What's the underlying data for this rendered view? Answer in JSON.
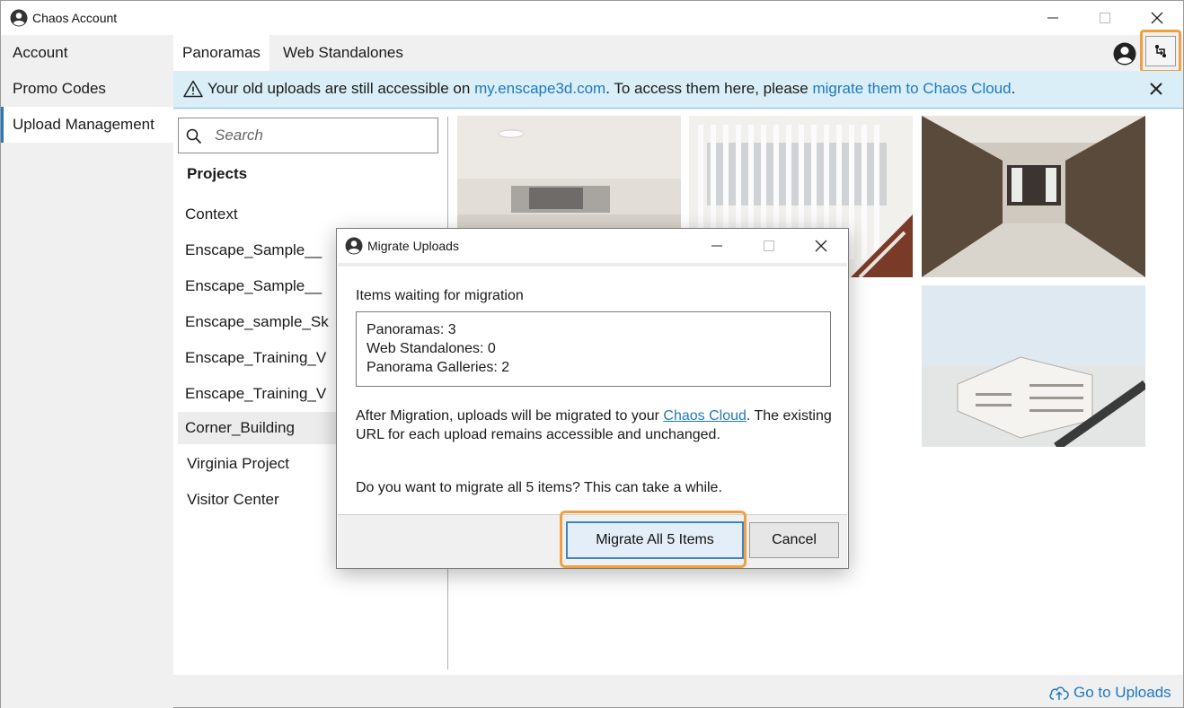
{
  "window": {
    "title": "Chaos Account"
  },
  "sidebar": {
    "items": [
      {
        "label": "Account"
      },
      {
        "label": "Promo Codes"
      },
      {
        "label": "Upload Management"
      }
    ]
  },
  "tabs": [
    {
      "label": "Panoramas"
    },
    {
      "label": "Web Standalones"
    }
  ],
  "banner": {
    "text_1": "Your old uploads are still accessible on ",
    "link_1": "my.enscape3d.com",
    "text_2": ". To access them here, please ",
    "link_2": "migrate them to Chaos Cloud",
    "text_3": "."
  },
  "search": {
    "placeholder": "Search"
  },
  "projects": {
    "heading": "Projects",
    "items": [
      "Context",
      "Enscape_Sample__",
      "Enscape_Sample__",
      "Enscape_sample_Sk",
      "Enscape_Training_V",
      "Enscape_Training_V",
      "Corner_Building",
      "Virginia Project",
      "Visitor Center"
    ]
  },
  "footer": {
    "go_to_uploads": "Go to Uploads"
  },
  "dialog": {
    "title": "Migrate Uploads",
    "items_label": "Items waiting for migration",
    "counts": [
      "Panoramas: 3",
      "Web Standalones: 0",
      "Panorama Galleries: 2"
    ],
    "para_1": "After Migration, uploads will be migrated to your ",
    "para_link": "Chaos Cloud",
    "para_2": ". The existing URL for each upload remains accessible and unchanged.",
    "question": "Do you want to migrate all 5 items? This can take a while.",
    "primary_button": "Migrate All 5 Items",
    "cancel_button": "Cancel"
  },
  "colors": {
    "accent": "#1f78c1",
    "highlight": "#f0a040",
    "banner_bg": "#d9eef7"
  }
}
